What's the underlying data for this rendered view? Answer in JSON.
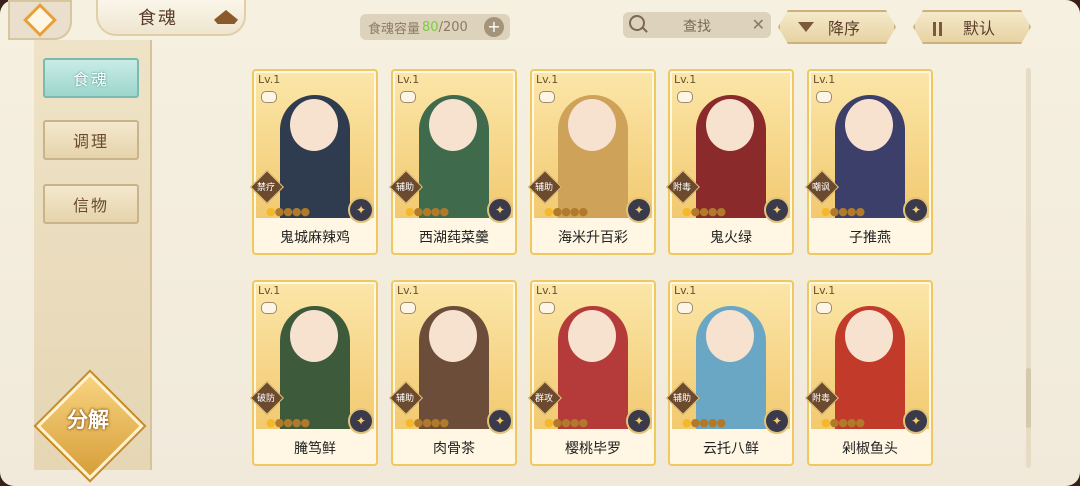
{
  "header": {
    "title": "食魂",
    "capacity_label": "食魂容量",
    "capacity_current": "80",
    "capacity_max": "/200",
    "capacity_plus": "+",
    "search_label": "查找",
    "search_clear": "✕",
    "sort_order_label": "降序",
    "sort_mode_label": "默认"
  },
  "sidebar": {
    "items": [
      {
        "label": "食魂",
        "active": true
      },
      {
        "label": "调理",
        "active": false
      },
      {
        "label": "信物",
        "active": false
      }
    ],
    "decompose_label": "分解"
  },
  "cards": [
    {
      "level": "Lv.1",
      "name": "鬼城麻辣鸡",
      "role": "禁疗",
      "stars": 1,
      "portrait_color": "#2f3b4e",
      "element": "✦"
    },
    {
      "level": "Lv.1",
      "name": "西湖莼菜羹",
      "role": "辅助",
      "stars": 1,
      "portrait_color": "#3f6b4c",
      "element": "✦"
    },
    {
      "level": "Lv.1",
      "name": "海米升百彩",
      "role": "辅助",
      "stars": 1,
      "portrait_color": "#cfa25a",
      "element": "✦"
    },
    {
      "level": "Lv.1",
      "name": "鬼火绿",
      "role": "附毒",
      "stars": 1,
      "portrait_color": "#8a2a2a",
      "element": "✦"
    },
    {
      "level": "Lv.1",
      "name": "子推燕",
      "role": "嘲讽",
      "stars": 1,
      "portrait_color": "#3c3f6a",
      "element": "✦"
    },
    {
      "level": "Lv.1",
      "name": "腌笃鲜",
      "role": "破防",
      "stars": 1,
      "portrait_color": "#3d5a3a",
      "element": "✦"
    },
    {
      "level": "Lv.1",
      "name": "肉骨茶",
      "role": "辅助",
      "stars": 1,
      "portrait_color": "#6b4d3a",
      "element": "✦"
    },
    {
      "level": "Lv.1",
      "name": "樱桃毕罗",
      "role": "群攻",
      "stars": 1,
      "portrait_color": "#b53a3a",
      "element": "✦"
    },
    {
      "level": "Lv.1",
      "name": "云托八鲜",
      "role": "辅助",
      "stars": 1,
      "portrait_color": "#6aa7c4",
      "element": "✦"
    },
    {
      "level": "Lv.1",
      "name": "剁椒鱼头",
      "role": "附毒",
      "stars": 1,
      "portrait_color": "#c23a2a",
      "element": "✦"
    }
  ]
}
